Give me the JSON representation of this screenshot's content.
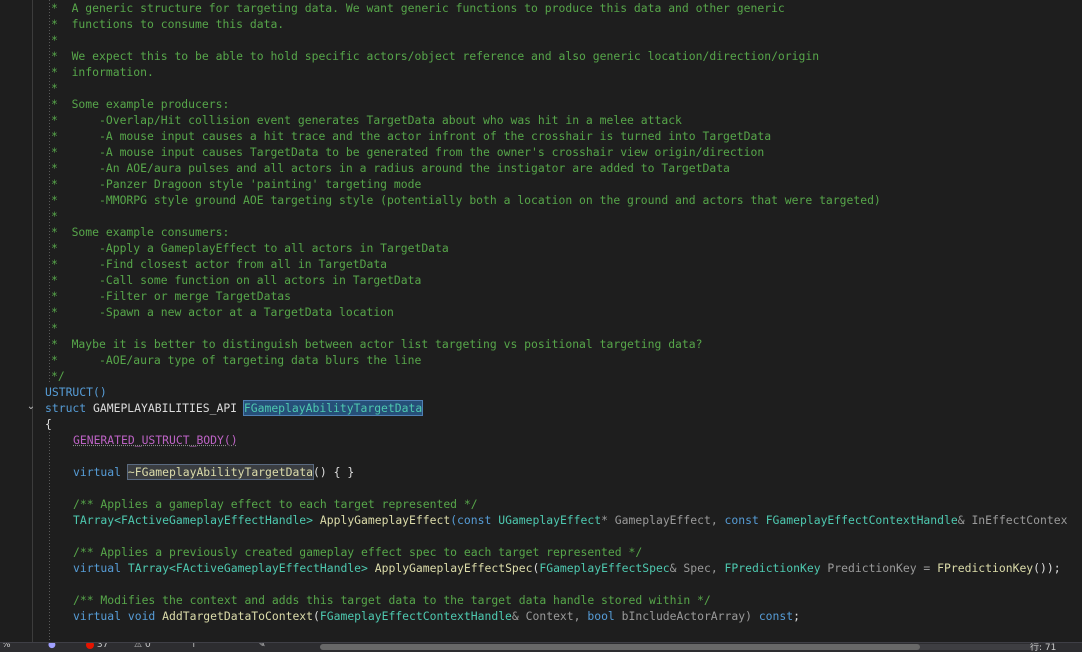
{
  "code": {
    "comment_lines": [
      "*  A generic structure for targeting data. We want generic functions to produce this data and other generic",
      "*  functions to consume this data.",
      "*",
      "*  We expect this to be able to hold specific actors/object reference and also generic location/direction/origin",
      "*  information.",
      "*",
      "*  Some example producers:",
      "*      -Overlap/Hit collision event generates TargetData about who was hit in a melee attack",
      "*      -A mouse input causes a hit trace and the actor infront of the crosshair is turned into TargetData",
      "*      -A mouse input causes TargetData to be generated from the owner's crosshair view origin/direction",
      "*      -An AOE/aura pulses and all actors in a radius around the instigator are added to TargetData",
      "*      -Panzer Dragoon style 'painting' targeting mode",
      "*      -MMORPG style ground AOE targeting style (potentially both a location on the ground and actors that were targeted)",
      "*",
      "*  Some example consumers:",
      "*      -Apply a GameplayEffect to all actors in TargetData",
      "*      -Find closest actor from all in TargetData",
      "*      -Call some function on all actors in TargetData",
      "*      -Filter or merge TargetDatas",
      "*      -Spawn a new actor at a TargetData location",
      "*",
      "*  Maybe it is better to distinguish between actor list targeting vs positional targeting data?",
      "*      -AOE/aura type of targeting data blurs the line",
      "*/"
    ],
    "ustruct": "USTRUCT()",
    "struct_kw": "struct",
    "api_macro": "GAMEPLAYABILITIES_API",
    "struct_name": "FGameplayAbilityTargetData",
    "open_brace": "{",
    "generated_body": "GENERATED_USTRUCT_BODY()",
    "virtual_kw": "virtual",
    "destructor": "~FGameplayAbilityTargetData",
    "destructor_tail": "() { }",
    "doc1": "/** Applies a gameplay effect to each target represented */",
    "l1_type": "TArray<FActiveGameplayEffectHandle>",
    "l1_fn": "ApplyGameplayEffect",
    "l1_p1": "(const ",
    "l1_t2": "UGameplayEffect",
    "l1_p2": "* GameplayEffect, ",
    "l1_k3": "const ",
    "l1_t3": "FGameplayEffectContextHandle",
    "l1_p3": "& InEffectContex",
    "doc2": "/** Applies a previously created gameplay effect spec to each target represented */",
    "l2_type": "TArray<FActiveGameplayEffectHandle>",
    "l2_fn": "ApplyGameplayEffectSpec",
    "l2_p1": "(",
    "l2_t1": "FGameplayEffectSpec",
    "l2_p2": "& Spec, ",
    "l2_t2": "FPredictionKey",
    "l2_p3": " PredictionKey = ",
    "l2_t3": "FPredictionKey",
    "l2_p4": "());",
    "doc3": "/** Modifies the context and adds this target data to the target data handle stored within */",
    "l3_kw": "virtual void",
    "l3_fn": "AddTargetDataToContext",
    "l3_p1": "(",
    "l3_t1": "FGameplayEffectContextHandle",
    "l3_p2": "& Context, ",
    "l3_k2": "bool",
    "l3_p3": " bIncludeActorArray) ",
    "l3_k3": "const",
    "l3_p4": ";"
  },
  "status": {
    "zoom": "% ",
    "errors": "37",
    "warnings": "0",
    "position": "行: 71"
  }
}
